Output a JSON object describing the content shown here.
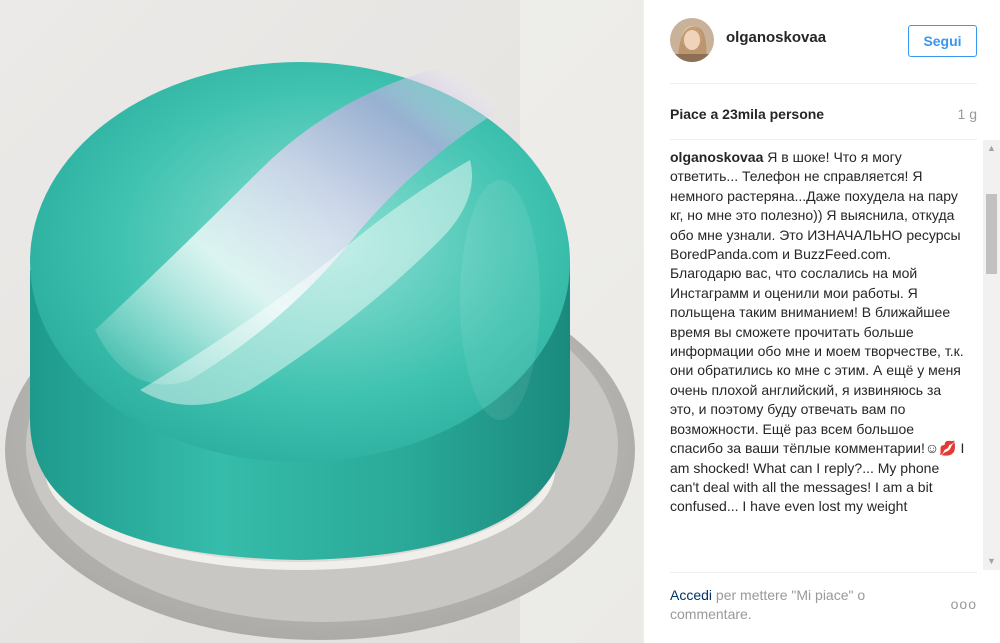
{
  "post": {
    "username": "olganoskovaa",
    "follow_label": "Segui",
    "likes_text": "Piace a 23mila persone",
    "age": "1 g",
    "caption_author": "olganoskovaa",
    "caption_text": "Я в шоке! Что я могу ответить... Телефон не справляется! Я немного растеряна...Даже похудела на пару кг, но мне это полезно)) Я выяснила, откуда обо мне узнали. Это ИЗНАЧАЛЬНО ресурсы BoredPanda.com и BuzzFeed.com. Благодарю вас, что сослались на мой Инстаграмм и оценили мои работы. Я польщена таким вниманием! В ближайшее время вы сможете прочитать больше информации обо мне и моем творчестве, т.к. они обратились ко мне с этим. А ещё у меня очень плохой английский, я извиняюсь за это, и поэтому буду отвечать вам по возможности. Ещё раз всем большое спасибо за ваши тёплые комментарии!☺💋 I am shocked! What can I reply?... My phone can't deal with all the messages! I am a bit confused... I have even lost my weight"
  },
  "footer": {
    "login_link": "Accedi",
    "login_suffix": " per mettere \"Mi piace\" o commentare.",
    "more_label": "ooo"
  },
  "scrollbar": {
    "up_arrow": "▲",
    "down_arrow": "▼"
  },
  "photo": {
    "subject": "mirror glaze cake",
    "colors": {
      "glaze": "#34b8a7",
      "glaze_dark": "#1f9d8f",
      "board": "#bfbdb9",
      "background": "#e7e6e4"
    }
  },
  "colors": {
    "accent": "#3897f0",
    "link": "#003569",
    "muted": "#999999",
    "text": "#262626"
  }
}
